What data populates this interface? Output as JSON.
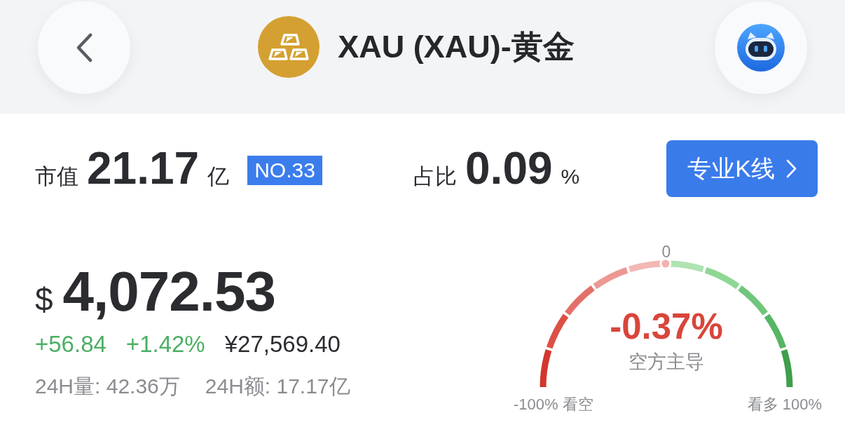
{
  "header": {
    "title": "XAU (XAU)-黄金"
  },
  "market": {
    "cap_label": "市值",
    "cap_value": "21.17",
    "cap_unit": "亿",
    "rank_badge": "NO.33",
    "share_label": "占比",
    "share_value": "0.09",
    "share_unit": "%",
    "kline_button": "专业K线"
  },
  "price": {
    "currency": "$",
    "value": "4,072.53",
    "rising": true,
    "change": "+56.84",
    "change_percent": "+1.42%",
    "cny_price": "¥27,569.40"
  },
  "stats": [
    "24H量: 42.36万",
    "24H额: 17.17亿"
  ],
  "sentiment_gauge": {
    "center_label": "0",
    "value": "-0.37%",
    "caption": "空方主导",
    "min_label": "-100% 看空",
    "max_label": "看多 100%",
    "level": 0.498
  }
}
